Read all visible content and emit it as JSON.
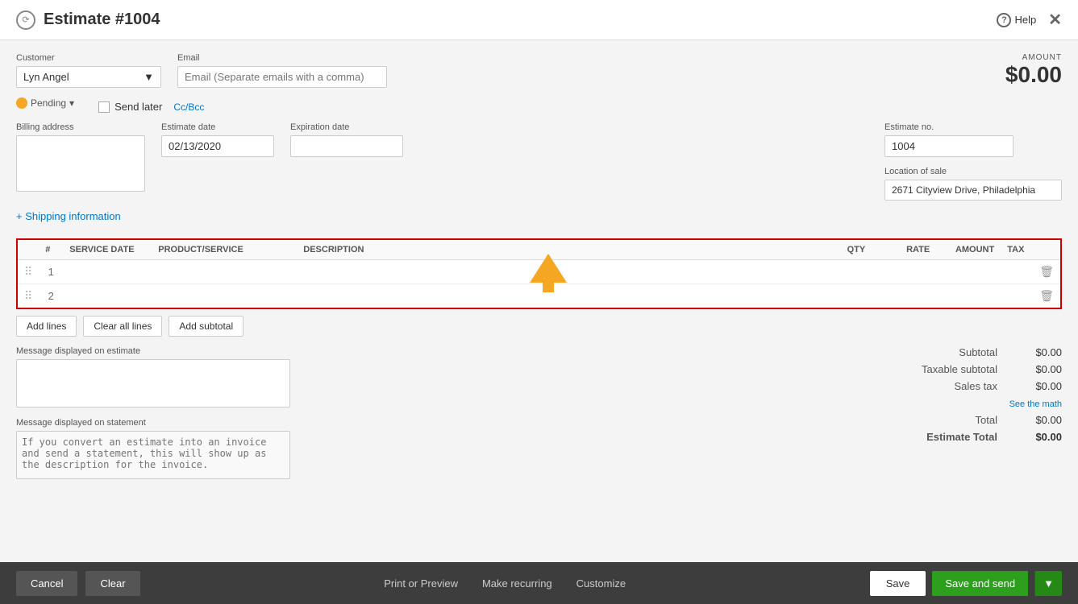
{
  "header": {
    "title": "Estimate #1004",
    "help_label": "Help",
    "icon_label": "clock-icon"
  },
  "form": {
    "customer": {
      "label": "Customer",
      "value": "Lyn Angel"
    },
    "email": {
      "label": "Email",
      "placeholder": "Email (Separate emails with a comma)"
    },
    "status": {
      "label": "Pending"
    },
    "send_later": {
      "label": "Send later"
    },
    "cc_bcc": "Cc/Bcc",
    "amount": {
      "label": "AMOUNT",
      "value": "$0.00"
    },
    "billing_address": {
      "label": "Billing address"
    },
    "estimate_date": {
      "label": "Estimate date",
      "value": "02/13/2020"
    },
    "expiration_date": {
      "label": "Expiration date",
      "value": ""
    },
    "estimate_no": {
      "label": "Estimate no.",
      "value": "1004"
    },
    "location_of_sale": {
      "label": "Location of sale",
      "value": "2671 Cityview Drive, Philadelphia"
    },
    "shipping_info": "+ Shipping information"
  },
  "table": {
    "columns": [
      "",
      "#",
      "SERVICE DATE",
      "PRODUCT/SERVICE",
      "DESCRIPTION",
      "QTY",
      "RATE",
      "AMOUNT",
      "TAX",
      ""
    ],
    "rows": [
      {
        "num": "1",
        "service_date": "",
        "product_service": "",
        "description": "",
        "qty": "",
        "rate": "",
        "amount": "",
        "tax": ""
      },
      {
        "num": "2",
        "service_date": "",
        "product_service": "",
        "description": "",
        "qty": "",
        "rate": "",
        "amount": "",
        "tax": ""
      }
    ],
    "add_lines": "Add lines",
    "clear_all_lines": "Clear all lines",
    "add_subtotal": "Add subtotal"
  },
  "totals": {
    "subtotal_label": "Subtotal",
    "subtotal_value": "$0.00",
    "taxable_subtotal_label": "Taxable subtotal",
    "taxable_subtotal_value": "$0.00",
    "sales_tax_label": "Sales tax",
    "sales_tax_value": "$0.00",
    "see_the_math": "See the math",
    "total_label": "Total",
    "total_value": "$0.00",
    "estimate_total_label": "Estimate Total",
    "estimate_total_value": "$0.00"
  },
  "messages": {
    "on_estimate_label": "Message displayed on estimate",
    "on_statement_label": "Message displayed on statement",
    "statement_placeholder": "If you convert an estimate into an invoice and send a statement, this will show up as the description for the invoice."
  },
  "footer": {
    "cancel": "Cancel",
    "clear": "Clear",
    "print_preview": "Print or Preview",
    "make_recurring": "Make recurring",
    "customize": "Customize",
    "save": "Save",
    "save_and_send": "Save and send"
  }
}
